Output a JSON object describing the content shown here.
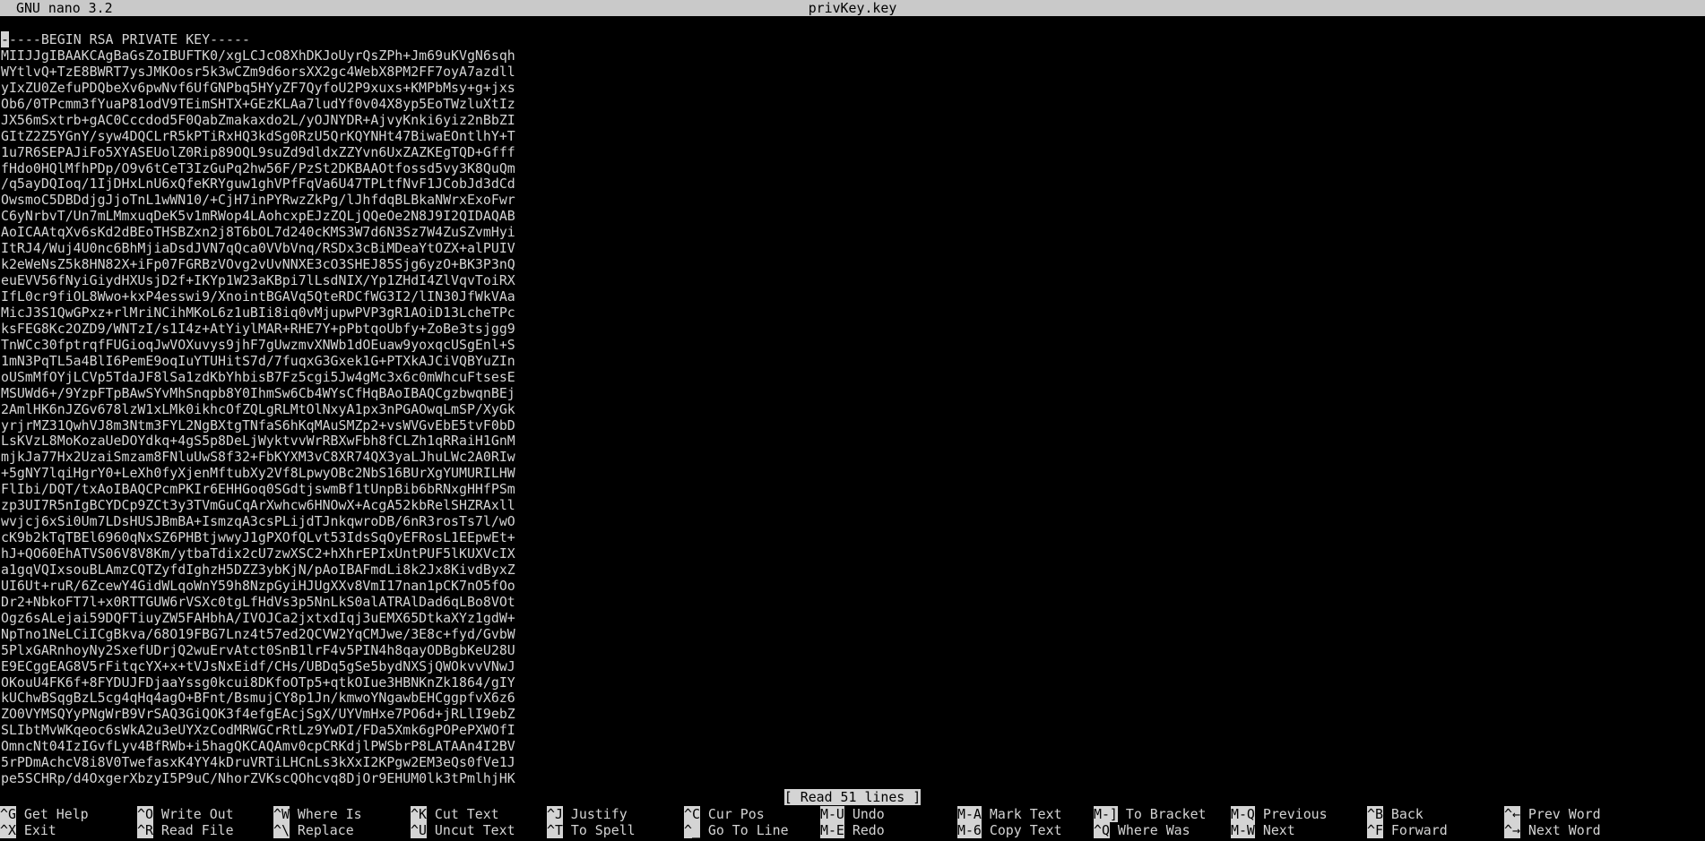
{
  "titlebar": {
    "app_version": "GNU nano 3.2",
    "filename": "privKey.key"
  },
  "editor": {
    "lines": [
      "-----BEGIN RSA PRIVATE KEY-----",
      "MIIJJgIBAAKCAgBaGsZoIBUFTK0/xgLCJcO8XhDKJoUyrQsZPh+Jm69uKVgN6sqh",
      "WYtlvQ+TzE8BWRT7ysJMKOosr5k3wCZm9d6orsXX2gc4WebX8PM2FF7oyA7azdll",
      "yIxZU0ZefuPDQbeXv6pwNvf6UfGNPbq5HYyZF7QyfoU2P9xuxs+KMPbMsy+g+jxs",
      "Ob6/0TPcmm3fYuaP81odV9TEimSHTX+GEzKLAa7ludYf0v04X8yp5EoTWzluXtIz",
      "JX56mSxtrb+gAC0Cccdod5F0QabZmakaxdo2L/yOJNYDR+AjvyKnki6yiz2nBbZI",
      "GItZ2Z5YGnY/syw4DQCLrR5kPTiRxHQ3kdSg0RzU5QrKQYNHt47BiwaEOntlhY+T",
      "1u7R6SEPAJiFo5XYASEUolZ0Rip89OQL9suZd9dldxZZYvn6UxZAZKEgTQD+Gfff",
      "fHdo0HQlMfhPDp/O9v6tCeT3IzGuPq2hw56F/PzSt2DKBAAOtfossd5vy3K8QuQm",
      "/q5ayDQIoq/1IjDHxLnU6xQfeKRYguw1ghVPfFqVa6U47TPLtfNvF1JCobJd3dCd",
      "OwsmoC5DBDdjgJjoTnL1wWN10/+CjH7inPYRwzZkPg/lJhfdqBLBkaNWrxExoFwr",
      "C6yNrbvT/Un7mLMmxuqDeK5v1mRWop4LAohcxpEJzZQLjQQeOe2N8J9I2QIDAQAB",
      "AoICAAtqXv6sKd2dBEoTHSBZxn2j8T6bOL7d240cKMS3W7d6N3Sz7W4ZuSZvmHyi",
      "ItRJ4/Wuj4U0nc6BhMjiaDsdJVN7qQca0VVbVnq/RSDx3cBiMDeaYtOZX+alPUIV",
      "k2eWeNsZ5k8HN82X+iFp07FGRBzVOvg2vUvNNXE3cO3SHEJ85Sjg6yzO+BK3P3nQ",
      "euEVV56fNyiGiydHXUsjD2f+IKYp1W23aKBpi7lLsdNIX/Yp1ZHdI4ZlVqvToiRX",
      "IfL0cr9fiOL8Wwo+kxP4esswi9/XnointBGAVq5QteRDCfWG3I2/lIN30JfWkVAa",
      "MicJ3S1QwGPxz+rlMriNCihMKoL6z1uBIi8iq0vMjupwPVP3gR1AOiD13LcheTPc",
      "ksFEG8Kc2OZD9/WNTzI/s1I4z+AtYiylMAR+RHE7Y+pPbtqoUbfy+ZoBe3tsjgg9",
      "TnWCc30fptrqfFUGioqJwVOXuvys9jhF7gUwzmvXNWb1dOEuaw9yoxqcUSgEnl+S",
      "1mN3PqTL5a4BlI6PemE9oqIuYTUHitS7d/7fuqxG3Gxek1G+PTXkAJCiVQBYuZIn",
      "oUSmMfOYjLCVp5TdaJF8lSa1zdKbYhbisB7Fz5cgi5Jw4gMc3x6c0mWhcuFtsesE",
      "MSUWd6+/9YzpFTpBAwSYvMhSnqpb8Y0IhmSw6Cb4WYsCfHqBAoIBAQCgzbwqnBEj",
      "2AmlHK6nJZGv678lzW1xLMk0ikhcOfZQLgRLMtOlNxyA1px3nPGAOwqLmSP/XyGk",
      "yrjrMZ31QwhVJ8m3Ntm3FYL2NgBXtgTNfaS6hKqMAuSMZp2+vsWVGvEbE5tvF0bD",
      "LsKVzL8MoKozaUeDOYdkq+4gS5p8DeLjWyktvvWrRBXwFbh8fCLZh1qRRaiH1GnM",
      "mjkJa77Hx2UzaiSmzam8FNluUwS8f32+FbKYXM3vC8XR74QX3yaLJhuLWc2A0RIw",
      "+5gNY7lqiHgrY0+LeXh0fyXjenMftubXy2Vf8LpwyOBc2NbS16BUrXgYUMURILHW",
      "FlIbi/DQT/txAoIBAQCPcmPKIr6EHHGoq0SGdtjswmBf1tUnpBib6bRNxgHHfPSm",
      "zp3UI7R5nIgBCYDCp9ZCt3y3TVmGuCqArXwhcw6HNOwX+AcgA52kbRelSHZRAxll",
      "wvjcj6xSi0Um7LDsHUSJBmBA+IsmzqA3csPLijdTJnkqwroDB/6nR3rosTs7l/wO",
      "cK9b2kTqTBEl6960qNxSZ6PHBtjwwyJ1gPXOfQLvt53IdsSqOyEFRosL1EEpwEt+",
      "hJ+QO60EhATVS06V8V8Km/ytbaTdix2cU7zwXSC2+hXhrEPIxUntPUF5lKUXVcIX",
      "a1gqVQIxsouBLAmzCQTZyfdIghzH5DZZ3ybKjN/pAoIBAFmdLi8k2Jx8KivdByxZ",
      "UI6Ut+ruR/6ZcewY4GidWLqoWnY59h8NzpGyiHJUgXXv8VmI17nan1pCK7nO5fOo",
      "Dr2+NbkoFT7l+x0RTTGUW6rVSXc0tgLfHdVs3p5NnLkS0alATRAlDad6qLBo8VOt",
      "Ogz6sALejai59DQFTiuyZW5FAHbhA/IVOJCa2jxtxdIqj3uEMX65DtkaXYz1gdW+",
      "NpTno1NeLCiICgBkva/68O19FBG7Lnz4t57ed2QCVW2YqCMJwe/3E8c+fyd/GvbW",
      "5PlxGARnhoyNy2SxefUDrjQ2wuErvAtct0SnB1lrF4v5PIN4h8qayODBgbKeU28U",
      "E9ECggEAG8V5rFitqcYX+x+tVJsNxEidf/CHs/UBDq5gSe5bydNXSjQWOkvvVNwJ",
      "OKouU4FK6f+8FYDUJFDjaaYssg0kcui8DKfoOTp5+qtkOIue3HBNKnZk1864/gIY",
      "kUChwBSqgBzL5cg4qHq4agO+BFnt/BsmujCY8p1Jn/kmwoYNgawbEHCggpfvX6z6",
      "ZO0VYMSQYyPNgWrB9VrSAQ3GiQOK3f4efgEAcjSgX/UYVmHxe7PO6d+jRLlI9ebZ",
      "SLIbtMvWKqeoc6sWkA2u3eUYXzCodMRWGCrRtLz9YwDI/FDa5Xmk6gPOPePXWOfI",
      "OmncNt04IzIGvfLyv4BfRWb+i5hagQKCAQAmv0cpCRKdjlPWSbrP8LATAAn4I2BV",
      "5rPDmAchcV8i8V0TwefasxK4YY4kDruVRTiLHCnLs3kXxI2KPgw2EM3eQs0fVe1J",
      "pe5SCHRp/d4OxgerXbzyI5P9uC/NhorZVKscQOhcvq8DjOr9EHUM0lk3tPmlhjHK"
    ]
  },
  "status": {
    "message": "[ Read 51 lines ]"
  },
  "shortcuts": {
    "row1": [
      {
        "key": "^G",
        "label": "Get Help"
      },
      {
        "key": "^O",
        "label": "Write Out"
      },
      {
        "key": "^W",
        "label": "Where Is"
      },
      {
        "key": "^K",
        "label": "Cut Text"
      },
      {
        "key": "^J",
        "label": "Justify"
      },
      {
        "key": "^C",
        "label": "Cur Pos"
      },
      {
        "key": "M-U",
        "label": "Undo"
      },
      {
        "key": "M-A",
        "label": "Mark Text"
      },
      {
        "key": "M-]",
        "label": "To Bracket"
      },
      {
        "key": "M-Q",
        "label": "Previous"
      },
      {
        "key": "^B",
        "label": "Back"
      },
      {
        "key": "^←",
        "label": "Prev Word"
      }
    ],
    "row2": [
      {
        "key": "^X",
        "label": "Exit"
      },
      {
        "key": "^R",
        "label": "Read File"
      },
      {
        "key": "^\\",
        "label": "Replace"
      },
      {
        "key": "^U",
        "label": "Uncut Text"
      },
      {
        "key": "^T",
        "label": "To Spell"
      },
      {
        "key": "^_",
        "label": "Go To Line"
      },
      {
        "key": "M-E",
        "label": "Redo"
      },
      {
        "key": "M-6",
        "label": "Copy Text"
      },
      {
        "key": "^Q",
        "label": "Where Was"
      },
      {
        "key": "M-W",
        "label": "Next"
      },
      {
        "key": "^F",
        "label": "Forward"
      },
      {
        "key": "^→",
        "label": "Next Word"
      }
    ]
  }
}
